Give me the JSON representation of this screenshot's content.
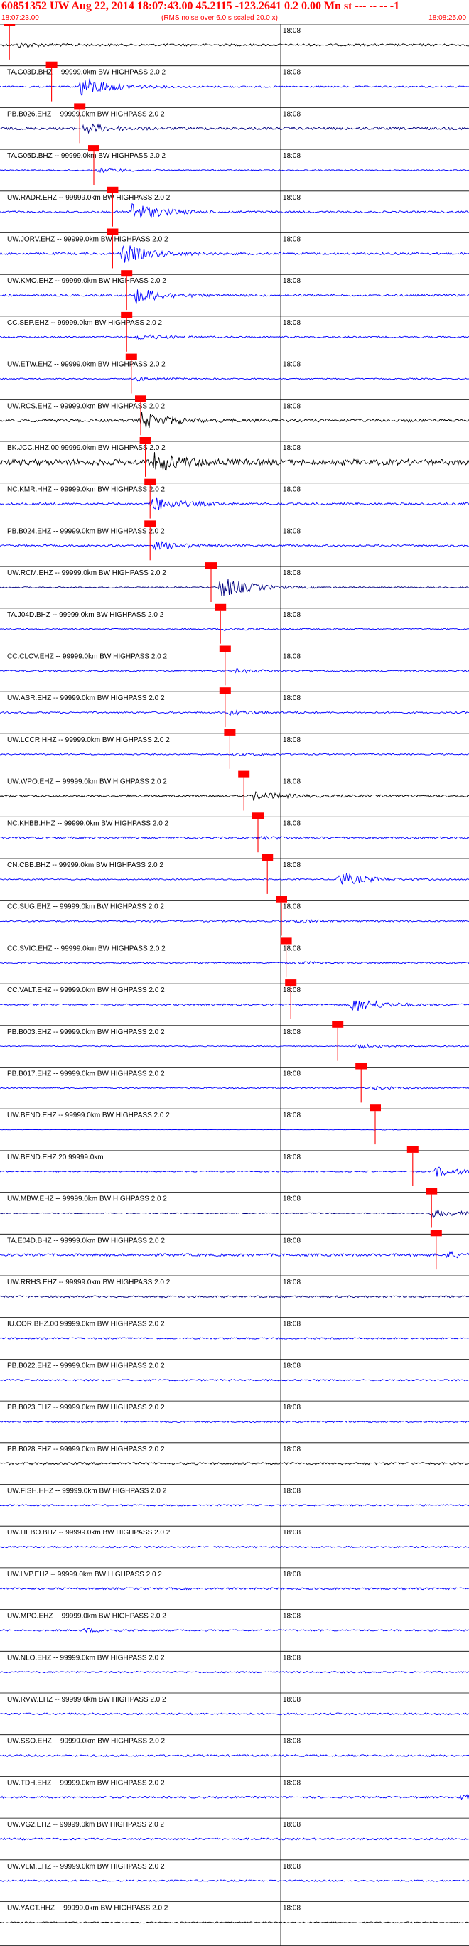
{
  "header": {
    "title": "60851352 UW Aug 22, 2014 18:07:43.00   45.2115 -123.2641  0.2 0.00 Mn st --- -- --  -1",
    "start_time": "18:07:23.00",
    "rms_note": "(RMS noise over 6.0 s scaled 20.0 x)",
    "end_time": "18:08:25.00"
  },
  "colors": {
    "red": "#ff0000",
    "blue": "#0000ff",
    "black": "#000000",
    "navy": "#000080",
    "grid": "#000000"
  },
  "chart_data": {
    "type": "line",
    "title": "60851352 UW Aug 22, 2014 18:07:43.00   45.2115 -123.2641  0.2 0.00 Mn st --- -- --  -1",
    "xlim": [
      "18:07:23.00",
      "18:08:25.00"
    ],
    "time_marker": "18:08",
    "grid": true,
    "series": [
      {
        "name": "",
        "color": "black",
        "amp": 0.35,
        "burst": 0.04,
        "burst_amp": 0.6,
        "pick": 0.02
      },
      {
        "name": "TA.G03D.BHZ -- 99999.0km BW  HIGHPASS  2.0  2",
        "color": "blue",
        "amp": 0.25,
        "burst": 0.17,
        "burst_amp": 3.5,
        "pick": 0.11
      },
      {
        "name": "PB.B026.EHZ -- 99999.0km BW  HIGHPASS  2.0  2",
        "color": "navy",
        "amp": 0.4,
        "burst": 0.18,
        "burst_amp": 1.5,
        "pick": 0.17
      },
      {
        "name": "TA.G05D.BHZ -- 99999.0km BW  HIGHPASS  2.0  2",
        "color": "blue",
        "amp": 0.2,
        "burst": 0.21,
        "burst_amp": 0.6,
        "pick": 0.2
      },
      {
        "name": "UW.RADR.EHZ -- 99999.0km BW  HIGHPASS  2.0  2",
        "color": "blue",
        "amp": 0.3,
        "burst": 0.28,
        "burst_amp": 3.0,
        "pick": 0.24
      },
      {
        "name": "UW.JORV.EHZ -- 99999.0km BW  HIGHPASS  2.0  2",
        "color": "blue",
        "amp": 0.35,
        "burst": 0.26,
        "burst_amp": 3.0,
        "pick": 0.24
      },
      {
        "name": "UW.KMO.EHZ -- 99999.0km BW  HIGHPASS  2.0  2",
        "color": "blue",
        "amp": 0.3,
        "burst": 0.29,
        "burst_amp": 2.4,
        "pick": 0.27
      },
      {
        "name": "CC.SEP.EHZ -- 99999.0km BW  HIGHPASS  2.0  2",
        "color": "blue",
        "amp": 0.25,
        "burst": 0.29,
        "burst_amp": 0.8,
        "pick": 0.27
      },
      {
        "name": "UW.ETW.EHZ -- 99999.0km BW  HIGHPASS  2.0  2",
        "color": "blue",
        "amp": 0.2,
        "burst": 0.29,
        "burst_amp": 0.5,
        "pick": 0.28
      },
      {
        "name": "UW.RCS.EHZ -- 99999.0km BW  HIGHPASS  2.0  2",
        "color": "black",
        "amp": 0.45,
        "burst": 0.3,
        "burst_amp": 2.5,
        "pick": 0.3
      },
      {
        "name": "BK.JCC.HHZ.00 99999.0km BW  HIGHPASS  2.0  2",
        "color": "black",
        "amp": 0.9,
        "burst": 0.33,
        "burst_amp": 2.5,
        "pick": 0.31
      },
      {
        "name": "NC.KMR.HHZ -- 99999.0km BW  HIGHPASS  2.0  2",
        "color": "blue",
        "amp": 0.35,
        "burst": 0.32,
        "burst_amp": 2.4,
        "pick": 0.32
      },
      {
        "name": "PB.B024.EHZ -- 99999.0km BW  HIGHPASS  2.0  2",
        "color": "blue",
        "amp": 0.3,
        "burst": 0.33,
        "burst_amp": 1.2,
        "pick": 0.32
      },
      {
        "name": "UW.RCM.EHZ -- 99999.0km BW  HIGHPASS  2.0  2",
        "color": "navy",
        "amp": 0.2,
        "burst": 0.47,
        "burst_amp": 3.5,
        "pick": 0.45
      },
      {
        "name": "TA.J04D.BHZ -- 99999.0km BW  HIGHPASS  2.0  2",
        "color": "blue",
        "amp": 0.2,
        "burst": 0.48,
        "burst_amp": 0.5,
        "pick": 0.47
      },
      {
        "name": "CC.CLCV.EHZ -- 99999.0km BW  HIGHPASS  2.0  2",
        "color": "blue",
        "amp": 0.25,
        "burst": 0.5,
        "burst_amp": 0.5,
        "pick": 0.48
      },
      {
        "name": "UW.ASR.EHZ -- 99999.0km BW  HIGHPASS  2.0  2",
        "color": "blue",
        "amp": 0.25,
        "burst": 0.49,
        "burst_amp": 0.7,
        "pick": 0.48
      },
      {
        "name": "UW.LCCR.HHZ -- 99999.0km BW  HIGHPASS  2.0  2",
        "color": "blue",
        "amp": 0.2,
        "burst": 0.5,
        "burst_amp": 0.4,
        "pick": 0.49
      },
      {
        "name": "UW.WPO.EHZ -- 99999.0km BW  HIGHPASS  2.0  2",
        "color": "black",
        "amp": 0.35,
        "burst": 0.54,
        "burst_amp": 1.2,
        "pick": 0.52
      },
      {
        "name": "NC.KHBB.HHZ -- 99999.0km BW  HIGHPASS  2.0  2",
        "color": "blue",
        "amp": 0.3,
        "burst": 0.55,
        "burst_amp": 0.4,
        "pick": 0.55
      },
      {
        "name": "CN.CBB.BHZ -- 99999.0km BW  HIGHPASS  2.0  2",
        "color": "blue",
        "amp": 0.2,
        "burst": 0.72,
        "burst_amp": 2.2,
        "pick": 0.57
      },
      {
        "name": "CC.SUG.EHZ -- 99999.0km BW  HIGHPASS  2.0  2",
        "color": "blue",
        "amp": 0.25,
        "burst": 0.62,
        "burst_amp": 0.5,
        "pick": 0.6
      },
      {
        "name": "CC.SVIC.EHZ -- 99999.0km BW  HIGHPASS  2.0  2",
        "color": "blue",
        "amp": 0.25,
        "burst": 0.63,
        "burst_amp": 0.3,
        "pick": 0.61
      },
      {
        "name": "CC.VALT.EHZ -- 99999.0km BW  HIGHPASS  2.0  2",
        "color": "blue",
        "amp": 0.25,
        "burst": 0.75,
        "burst_amp": 2.3,
        "pick": 0.62
      },
      {
        "name": "PB.B003.EHZ -- 99999.0km BW  HIGHPASS  2.0  2",
        "color": "blue",
        "amp": 0.15,
        "burst": 0.76,
        "burst_amp": 0.6,
        "pick": 0.72
      },
      {
        "name": "PB.B017.EHZ -- 99999.0km BW  HIGHPASS  2.0  2",
        "color": "blue",
        "amp": 0.2,
        "burst": 0.79,
        "burst_amp": 0.5,
        "pick": 0.77
      },
      {
        "name": "UW.BEND.EHZ -- 99999.0km BW  HIGHPASS  2.0  2",
        "color": "blue",
        "amp": 0.05,
        "burst": 0.8,
        "burst_amp": 0.1,
        "pick": 0.8
      },
      {
        "name": "UW.BEND.EHZ.20 99999.0km",
        "color": "blue",
        "amp": 0.2,
        "burst": 0.93,
        "burst_amp": 1.5,
        "pick": 0.88
      },
      {
        "name": "UW.MBW.EHZ -- 99999.0km BW  HIGHPASS  2.0  2",
        "color": "navy",
        "amp": 0.15,
        "burst": 0.92,
        "burst_amp": 1.4,
        "pick": 0.92
      },
      {
        "name": "TA.E04D.BHZ -- 99999.0km BW  HIGHPASS  2.0  2",
        "color": "blue",
        "amp": 0.4,
        "burst": 0.95,
        "burst_amp": 0.8,
        "pick": 0.93
      },
      {
        "name": "UW.RRHS.EHZ -- 99999.0km BW  HIGHPASS  2.0  2",
        "color": "navy",
        "amp": 0.3,
        "burst": -1,
        "burst_amp": 0,
        "pick": -1
      },
      {
        "name": "IU.COR.BHZ.00 99999.0km BW  HIGHPASS  2.0  2",
        "color": "blue",
        "amp": 0.25,
        "burst": -1,
        "burst_amp": 0,
        "pick": -1
      },
      {
        "name": "PB.B022.EHZ -- 99999.0km BW  HIGHPASS  2.0  2",
        "color": "blue",
        "amp": 0.25,
        "burst": -1,
        "burst_amp": 0,
        "pick": -1
      },
      {
        "name": "PB.B023.EHZ -- 99999.0km BW  HIGHPASS  2.0  2",
        "color": "blue",
        "amp": 0.25,
        "burst": -1,
        "burst_amp": 0,
        "pick": -1
      },
      {
        "name": "PB.B028.EHZ -- 99999.0km BW  HIGHPASS  2.0  2",
        "color": "black",
        "amp": 0.35,
        "burst": -1,
        "burst_amp": 0,
        "pick": -1
      },
      {
        "name": "UW.FISH.HHZ -- 99999.0km BW  HIGHPASS  2.0  2",
        "color": "blue",
        "amp": 0.25,
        "burst": -1,
        "burst_amp": 0,
        "pick": -1
      },
      {
        "name": "UW.HEBO.BHZ -- 99999.0km BW  HIGHPASS  2.0  2",
        "color": "blue",
        "amp": 0.25,
        "burst": -1,
        "burst_amp": 0,
        "pick": -1
      },
      {
        "name": "UW.LVP.EHZ -- 99999.0km BW  HIGHPASS  2.0  2",
        "color": "blue",
        "amp": 0.3,
        "burst": -1,
        "burst_amp": 0,
        "pick": -1
      },
      {
        "name": "UW.MPO.EHZ -- 99999.0km BW  HIGHPASS  2.0  2",
        "color": "blue",
        "amp": 0.25,
        "burst": 0.18,
        "burst_amp": 0.5,
        "pick": -1
      },
      {
        "name": "UW.NLO.EHZ -- 99999.0km BW  HIGHPASS  2.0  2",
        "color": "blue",
        "amp": 0.25,
        "burst": -1,
        "burst_amp": 0,
        "pick": -1
      },
      {
        "name": "UW.RVW.EHZ -- 99999.0km BW  HIGHPASS  2.0  2",
        "color": "blue",
        "amp": 0.3,
        "burst": -1,
        "burst_amp": 0,
        "pick": -1
      },
      {
        "name": "UW.SSO.EHZ -- 99999.0km BW  HIGHPASS  2.0  2",
        "color": "blue",
        "amp": 0.3,
        "burst": -1,
        "burst_amp": 0,
        "pick": -1
      },
      {
        "name": "UW.TDH.EHZ -- 99999.0km BW  HIGHPASS  2.0  2",
        "color": "blue",
        "amp": 0.3,
        "burst": 0.98,
        "burst_amp": 0.7,
        "pick": -1
      },
      {
        "name": "UW.VG2.EHZ -- 99999.0km BW  HIGHPASS  2.0  2",
        "color": "blue",
        "amp": 0.3,
        "burst": -1,
        "burst_amp": 0,
        "pick": -1
      },
      {
        "name": "UW.VLM.EHZ -- 99999.0km BW  HIGHPASS  2.0  2",
        "color": "blue",
        "amp": 0.25,
        "burst": -1,
        "burst_amp": 0,
        "pick": -1
      },
      {
        "name": "UW.YACT.HHZ -- 99999.0km BW  HIGHPASS  2.0  2",
        "color": "black",
        "amp": 0.2,
        "burst": -1,
        "burst_amp": 0,
        "pick": -1
      }
    ]
  }
}
